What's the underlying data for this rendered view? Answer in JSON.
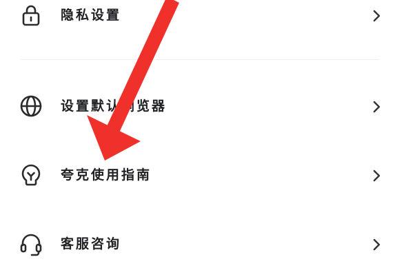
{
  "menu": {
    "items": [
      {
        "label": "隐私设置",
        "icon": "lock-icon"
      },
      {
        "label": "设置默认浏览器",
        "icon": "globe-icon"
      },
      {
        "label": "夸克使用指南",
        "icon": "lightbulb-icon"
      },
      {
        "label": "客服咨询",
        "icon": "headset-icon"
      }
    ]
  },
  "colors": {
    "text": "#202124",
    "icon": "#2b2b2b",
    "chevron": "#333333",
    "divider": "#eeeeee",
    "annotation_arrow": "#f0312b"
  }
}
